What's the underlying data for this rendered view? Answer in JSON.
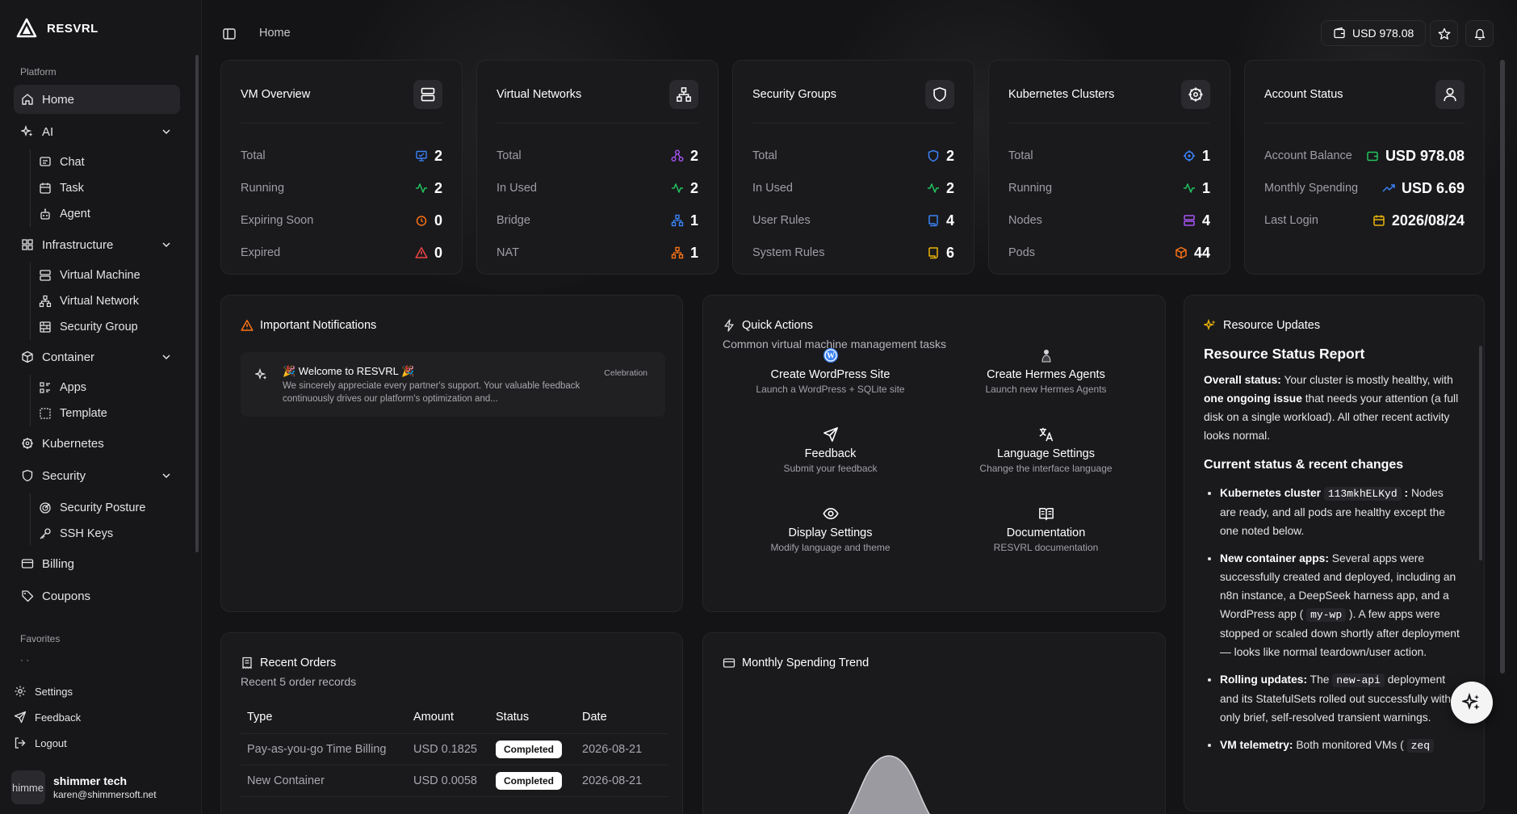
{
  "brand": {
    "name": "RESVRL"
  },
  "sidebar": {
    "platform_label": "Platform",
    "home": "Home",
    "ai": {
      "label": "AI",
      "items": [
        "Chat",
        "Task",
        "Agent"
      ]
    },
    "infrastructure": {
      "label": "Infrastructure",
      "items": [
        "Virtual Machine",
        "Virtual Network",
        "Security Group"
      ]
    },
    "container": {
      "label": "Container",
      "items": [
        "Apps",
        "Template"
      ]
    },
    "kubernetes": "Kubernetes",
    "security": {
      "label": "Security",
      "items": [
        "Security Posture",
        "SSH Keys"
      ]
    },
    "billing": "Billing",
    "coupons": "Coupons",
    "favorites_label": "Favorites",
    "favorites_placeholder": "· ·",
    "footer": {
      "settings": "Settings",
      "feedback": "Feedback",
      "logout": "Logout"
    },
    "user": {
      "avatar_text": "himme",
      "name": "shimmer tech",
      "email": "karen@shimmersoft.net"
    }
  },
  "topbar": {
    "breadcrumb": "Home",
    "balance": "USD 978.08"
  },
  "stats": {
    "vm": {
      "title": "VM Overview",
      "rows": [
        {
          "label": "Total",
          "value": "2"
        },
        {
          "label": "Running",
          "value": "2"
        },
        {
          "label": "Expiring Soon",
          "value": "0"
        },
        {
          "label": "Expired",
          "value": "0"
        }
      ]
    },
    "vnet": {
      "title": "Virtual Networks",
      "rows": [
        {
          "label": "Total",
          "value": "2"
        },
        {
          "label": "In Used",
          "value": "2"
        },
        {
          "label": "Bridge",
          "value": "1"
        },
        {
          "label": "NAT",
          "value": "1"
        }
      ]
    },
    "sg": {
      "title": "Security Groups",
      "rows": [
        {
          "label": "Total",
          "value": "2"
        },
        {
          "label": "In Used",
          "value": "2"
        },
        {
          "label": "User Rules",
          "value": "4"
        },
        {
          "label": "System Rules",
          "value": "6"
        }
      ]
    },
    "k8s": {
      "title": "Kubernetes Clusters",
      "rows": [
        {
          "label": "Total",
          "value": "1"
        },
        {
          "label": "Running",
          "value": "1"
        },
        {
          "label": "Nodes",
          "value": "4"
        },
        {
          "label": "Pods",
          "value": "44"
        }
      ]
    },
    "account": {
      "title": "Account Status",
      "rows": [
        {
          "label": "Account Balance",
          "value": "USD 978.08"
        },
        {
          "label": "Monthly Spending",
          "value": "USD 6.69"
        },
        {
          "label": "Last Login",
          "value": "2026/08/24"
        }
      ]
    }
  },
  "notifications": {
    "title": "Important Notifications",
    "item": {
      "title": "🎉 Welcome to RESVRL 🎉",
      "body": "We sincerely appreciate every partner's support. Your valuable feedback continuously drives our platform's optimization and...",
      "tag": "Celebration"
    }
  },
  "quick_actions": {
    "title": "Quick Actions",
    "subtitle": "Common virtual machine management tasks",
    "items": [
      {
        "title": "Create WordPress Site",
        "desc": "Launch a WordPress + SQLite site"
      },
      {
        "title": "Create Hermes Agents",
        "desc": "Launch new Hermes Agents"
      },
      {
        "title": "Feedback",
        "desc": "Submit your feedback"
      },
      {
        "title": "Language Settings",
        "desc": "Change the interface language"
      },
      {
        "title": "Display Settings",
        "desc": "Modify language and theme"
      },
      {
        "title": "Documentation",
        "desc": "RESVRL documentation"
      }
    ]
  },
  "resource_updates": {
    "title": "Resource Updates",
    "heading": "Resource Status Report",
    "overall_label": "Overall status:",
    "overall_text_1": "Your cluster is mostly healthy, with",
    "overall_bold": "one ongoing issue",
    "overall_text_2": "that needs your attention (a full disk on a single workload). All other recent activity looks normal.",
    "changes_heading": "Current status & recent changes",
    "bullets": [
      {
        "label": "Kubernetes cluster",
        "code": "113mkhELKyd",
        "after": ":",
        "text": "Nodes are ready, and all pods are healthy except the one noted below."
      },
      {
        "label": "New container apps:",
        "text_1": "Several apps were successfully created and deployed, including an n8n instance, a DeepSeek harness app, and a WordPress app (",
        "code": "my-wp",
        "text_2": "). A few apps were stopped or scaled down shortly after deployment — looks like normal teardown/user action."
      },
      {
        "label": "Rolling updates:",
        "text_1": "The",
        "code": "new-api",
        "text_2": "deployment and its StatefulSets rolled out successfully with only brief, self-resolved transient warnings."
      },
      {
        "label": "VM telemetry:",
        "text_1": "Both monitored VMs (",
        "code": "zeq",
        "text_2": ""
      }
    ]
  },
  "orders": {
    "title": "Recent Orders",
    "subtitle": "Recent 5 order records",
    "columns": [
      "Type",
      "Amount",
      "Status",
      "Date"
    ],
    "rows": [
      {
        "type": "Pay-as-you-go Time Billing",
        "amount": "USD 0.1825",
        "status": "Completed",
        "date": "2026-08-21"
      },
      {
        "type": "New Container",
        "amount": "USD 0.0058",
        "status": "Completed",
        "date": "2026-08-21"
      }
    ]
  },
  "spending": {
    "title": "Monthly Spending Trend"
  },
  "colors": {
    "accent_green": "#22c55e",
    "accent_blue": "#3b82f6",
    "accent_orange": "#f97316",
    "accent_red": "#ef4444",
    "accent_purple": "#a855f7",
    "accent_yellow": "#eab308"
  }
}
